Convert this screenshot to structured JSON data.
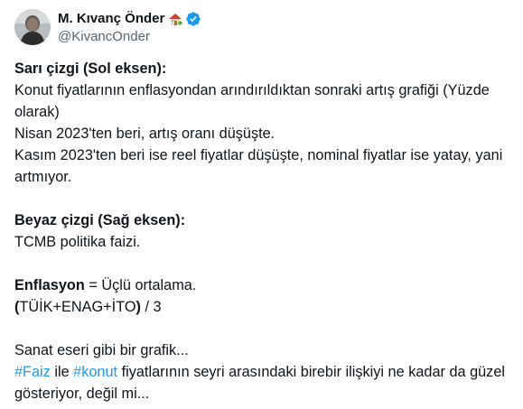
{
  "author": {
    "display_name": "M. Kıvanç Önder",
    "handle": "@KivancOnder",
    "emoji_icon": "house-with-garden-icon",
    "verified_icon": "verified-badge-icon",
    "verified_color": "#1d9bf0"
  },
  "tweet": {
    "yellow_heading": "Sarı çizgi (Sol eksen):",
    "yellow_line1": "Konut fiyatlarının enflasyondan arındırıldıktan sonraki artış grafiği (Yüzde olarak)",
    "yellow_line2": "Nisan 2023'ten beri, artış oranı düşüşte.",
    "yellow_line3": "Kasım 2023'ten beri ise reel fiyatlar düşüşte, nominal fiyatlar ise yatay, yani artmıyor.",
    "white_heading": "Beyaz çizgi (Sağ eksen):",
    "white_line1": "TCMB politika faizi.",
    "inflation_bold": "Enflasyon",
    "inflation_rest": " = Üçlü ortalama.",
    "formula_bold": "(",
    "formula_text": "TÜİK+ENAG+İTO",
    "formula_bold2": ")",
    "formula_rest": " / 3",
    "closing_line1": "Sanat eseri gibi bir grafik...",
    "hashtag_faiz": "#Faiz",
    "text_ile": " ile ",
    "hashtag_konut": "#konut",
    "closing_line2_rest": " fiyatlarının seyri arasındaki birebir ilişkiyi ne kadar da güzel gösteriyor, değil mi..."
  },
  "colors": {
    "text": "#0f1419",
    "secondary": "#536471",
    "link": "#1d9bf0"
  }
}
